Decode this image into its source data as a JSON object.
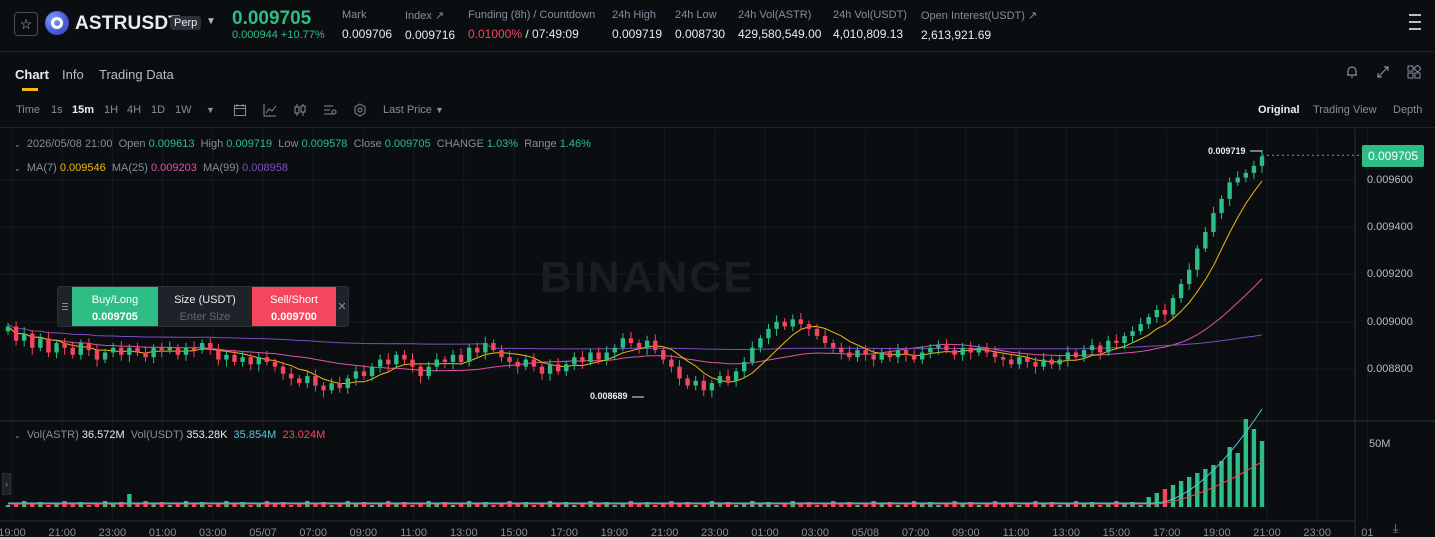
{
  "ticker": {
    "symbol": "ASTRUSDT",
    "perp_badge": "Perp",
    "last_price": "0.009705",
    "mark_sub": "0.000944 +10.77%",
    "stats": [
      {
        "label": "Mark",
        "value": "0.009706"
      },
      {
        "label": "Index ↗",
        "value": "0.009716"
      },
      {
        "label": "Funding (8h) / Countdown",
        "value_red": "0.01000%",
        "value": " / 07:49:09"
      },
      {
        "label": "24h High",
        "value": "0.009719"
      },
      {
        "label": "24h Low",
        "value": "0.008730"
      },
      {
        "label": "24h Vol(ASTR)",
        "value": "429,580,549.00"
      },
      {
        "label": "24h Vol(USDT)",
        "value": "4,010,809.13"
      },
      {
        "label": "Open Interest(USDT) ↗",
        "value": "2,613,921.69"
      }
    ]
  },
  "tabs": {
    "chart": "Chart",
    "info": "Info",
    "trading_data": "Trading Data"
  },
  "toolbar": {
    "time": "Time",
    "intervals": [
      "1s",
      "15m",
      "1H",
      "4H",
      "1D",
      "1W"
    ],
    "active_interval": "15m",
    "last_price": "Last Price",
    "views": [
      "Original",
      "Trading View",
      "Depth"
    ],
    "active_view": "Original"
  },
  "legend": {
    "ohlc_date": "2026/05/08 21:00",
    "open_lbl": "Open",
    "open": "0.009613",
    "high_lbl": "High",
    "high": "0.009719",
    "low_lbl": "Low",
    "low": "0.009578",
    "close_lbl": "Close",
    "close": "0.009705",
    "change_lbl": "CHANGE",
    "change": "1.03%",
    "range_lbl": "Range",
    "range": "1.46%",
    "ma7_lbl": "MA(7)",
    "ma7": "0.009546",
    "ma25_lbl": "MA(25)",
    "ma25": "0.009203",
    "ma99_lbl": "MA(99)",
    "ma99": "0.008958",
    "vol_astr_lbl": "Vol(ASTR)",
    "vol_astr": "36.572M",
    "vol_usdt_lbl": "Vol(USDT)",
    "vol_usdt": "353.28K",
    "vol_ma1": "35.854M",
    "vol_ma2": "23.024M"
  },
  "quick_order": {
    "buy_label": "Buy/Long",
    "buy_price": "0.009705",
    "size_label": "Size (USDT)",
    "size_placeholder": "Enter Size",
    "sell_label": "Sell/Short",
    "sell_price": "0.009700"
  },
  "watermark": "BINANCE",
  "price_axis": [
    "0.009600",
    "0.009400",
    "0.009200",
    "0.009000",
    "0.008800"
  ],
  "current_price_tag": "0.009705",
  "high_marker": "0.009719",
  "low_marker": "0.008689",
  "volume_axis": "50M",
  "time_axis": [
    "19:00",
    "21:00",
    "23:00",
    "01:00",
    "03:00",
    "05/07",
    "07:00",
    "09:00",
    "11:00",
    "13:00",
    "15:00",
    "17:00",
    "19:00",
    "21:00",
    "23:00",
    "01:00",
    "03:00",
    "05/08",
    "07:00",
    "09:00",
    "11:00",
    "13:00",
    "15:00",
    "17:00",
    "19:00",
    "21:00",
    "23:00",
    "01"
  ],
  "colors": {
    "up": "#2ebd85",
    "down": "#f6465d",
    "ma7": "#f0b90b",
    "ma25": "#e051a9",
    "ma99": "#7b4ec4",
    "accent": "#f0b90b"
  },
  "chart_data": {
    "type": "candlestick",
    "interval": "15m",
    "y_range": [
      0.0087,
      0.0098
    ],
    "closes": [
      0.00898,
      0.00892,
      0.00895,
      0.00889,
      0.00893,
      0.00887,
      0.00891,
      0.00889,
      0.00886,
      0.00891,
      0.00888,
      0.00884,
      0.00887,
      0.00889,
      0.00886,
      0.00889,
      0.00887,
      0.00885,
      0.00889,
      0.00888,
      0.00889,
      0.00886,
      0.00889,
      0.00888,
      0.00891,
      0.00888,
      0.00884,
      0.00886,
      0.00883,
      0.00885,
      0.00882,
      0.00885,
      0.00883,
      0.00881,
      0.00878,
      0.00876,
      0.00874,
      0.00877,
      0.00873,
      0.00871,
      0.00874,
      0.00872,
      0.00876,
      0.00879,
      0.00877,
      0.00881,
      0.00884,
      0.00882,
      0.00886,
      0.00884,
      0.00881,
      0.00877,
      0.00881,
      0.00884,
      0.00883,
      0.00886,
      0.00883,
      0.00889,
      0.00887,
      0.00891,
      0.00888,
      0.00885,
      0.00883,
      0.00881,
      0.00884,
      0.00881,
      0.00878,
      0.00882,
      0.00879,
      0.00882,
      0.00885,
      0.00883,
      0.00887,
      0.00884,
      0.00887,
      0.00889,
      0.00893,
      0.00891,
      0.00889,
      0.00892,
      0.00888,
      0.00884,
      0.00881,
      0.00876,
      0.00873,
      0.00875,
      0.00871,
      0.00874,
      0.00877,
      0.00875,
      0.00879,
      0.00883,
      0.00889,
      0.00893,
      0.00897,
      0.009,
      0.00898,
      0.00901,
      0.00899,
      0.00897,
      0.00894,
      0.00891,
      0.00889,
      0.00887,
      0.00885,
      0.00888,
      0.00886,
      0.00884,
      0.00887,
      0.00885,
      0.00888,
      0.00886,
      0.00884,
      0.00887,
      0.00889,
      0.0089,
      0.00888,
      0.00886,
      0.00889,
      0.00887,
      0.00889,
      0.00887,
      0.00885,
      0.00884,
      0.00882,
      0.00885,
      0.00883,
      0.00881,
      0.00884,
      0.00882,
      0.00884,
      0.00887,
      0.00885,
      0.00888,
      0.0089,
      0.00887,
      0.00892,
      0.00891,
      0.00894,
      0.00896,
      0.00899,
      0.00902,
      0.00905,
      0.00903,
      0.0091,
      0.00916,
      0.00922,
      0.00931,
      0.00938,
      0.00946,
      0.00952,
      0.00959,
      0.00961,
      0.00963,
      0.00966,
      0.0097
    ]
  }
}
